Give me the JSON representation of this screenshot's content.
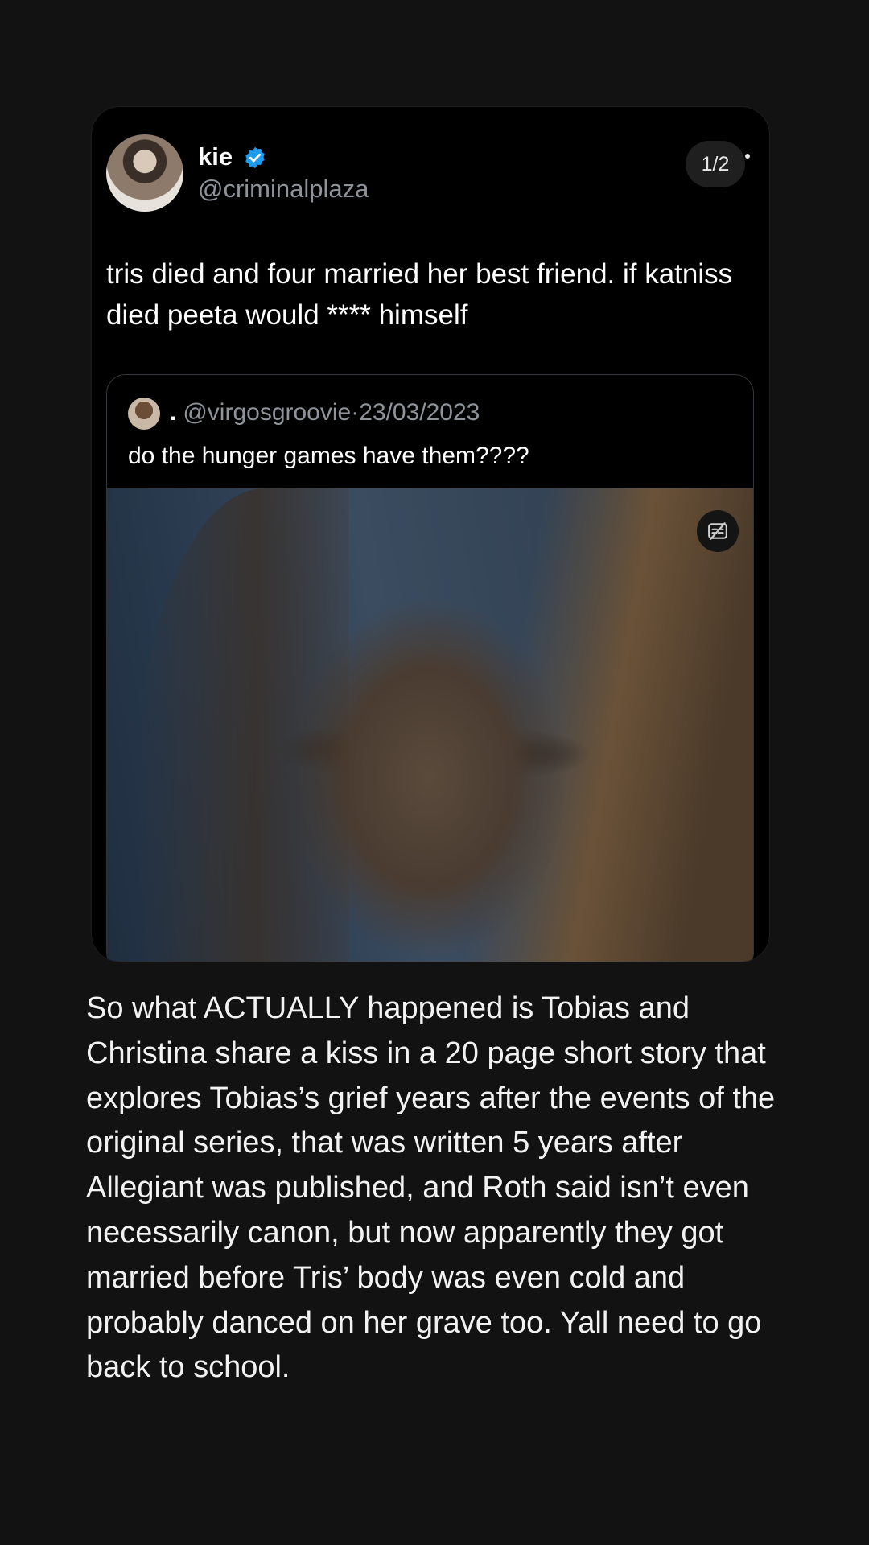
{
  "post": {
    "author": {
      "display_name": "kie",
      "handle": "@criminalplaza",
      "verified": true
    },
    "page_indicator": "1/2",
    "text": "tris died and four married her best friend. if katniss died peeta would **** himself",
    "quoted": {
      "handle": "@virgosgroovie",
      "separator": "·",
      "date": "23/03/2023",
      "text": "do the hunger games have them????",
      "image_alt_icon": "caption-icon"
    }
  },
  "body_text": "So what ACTUALLY happened is Tobias and Christina share a kiss in a 20 page short story that explores Tobias’s grief years after the events of the original series, that was written 5 years after Allegiant was published, and Roth said isn’t even necessarily canon, but now apparently they got married before Tris’ body was even cold and probably danced on her grave too. Yall need to go back to school.",
  "colors": {
    "background": "#121212",
    "card": "#000000",
    "verified_badge": "#1d9bf0",
    "muted_text": "#8f949a"
  }
}
